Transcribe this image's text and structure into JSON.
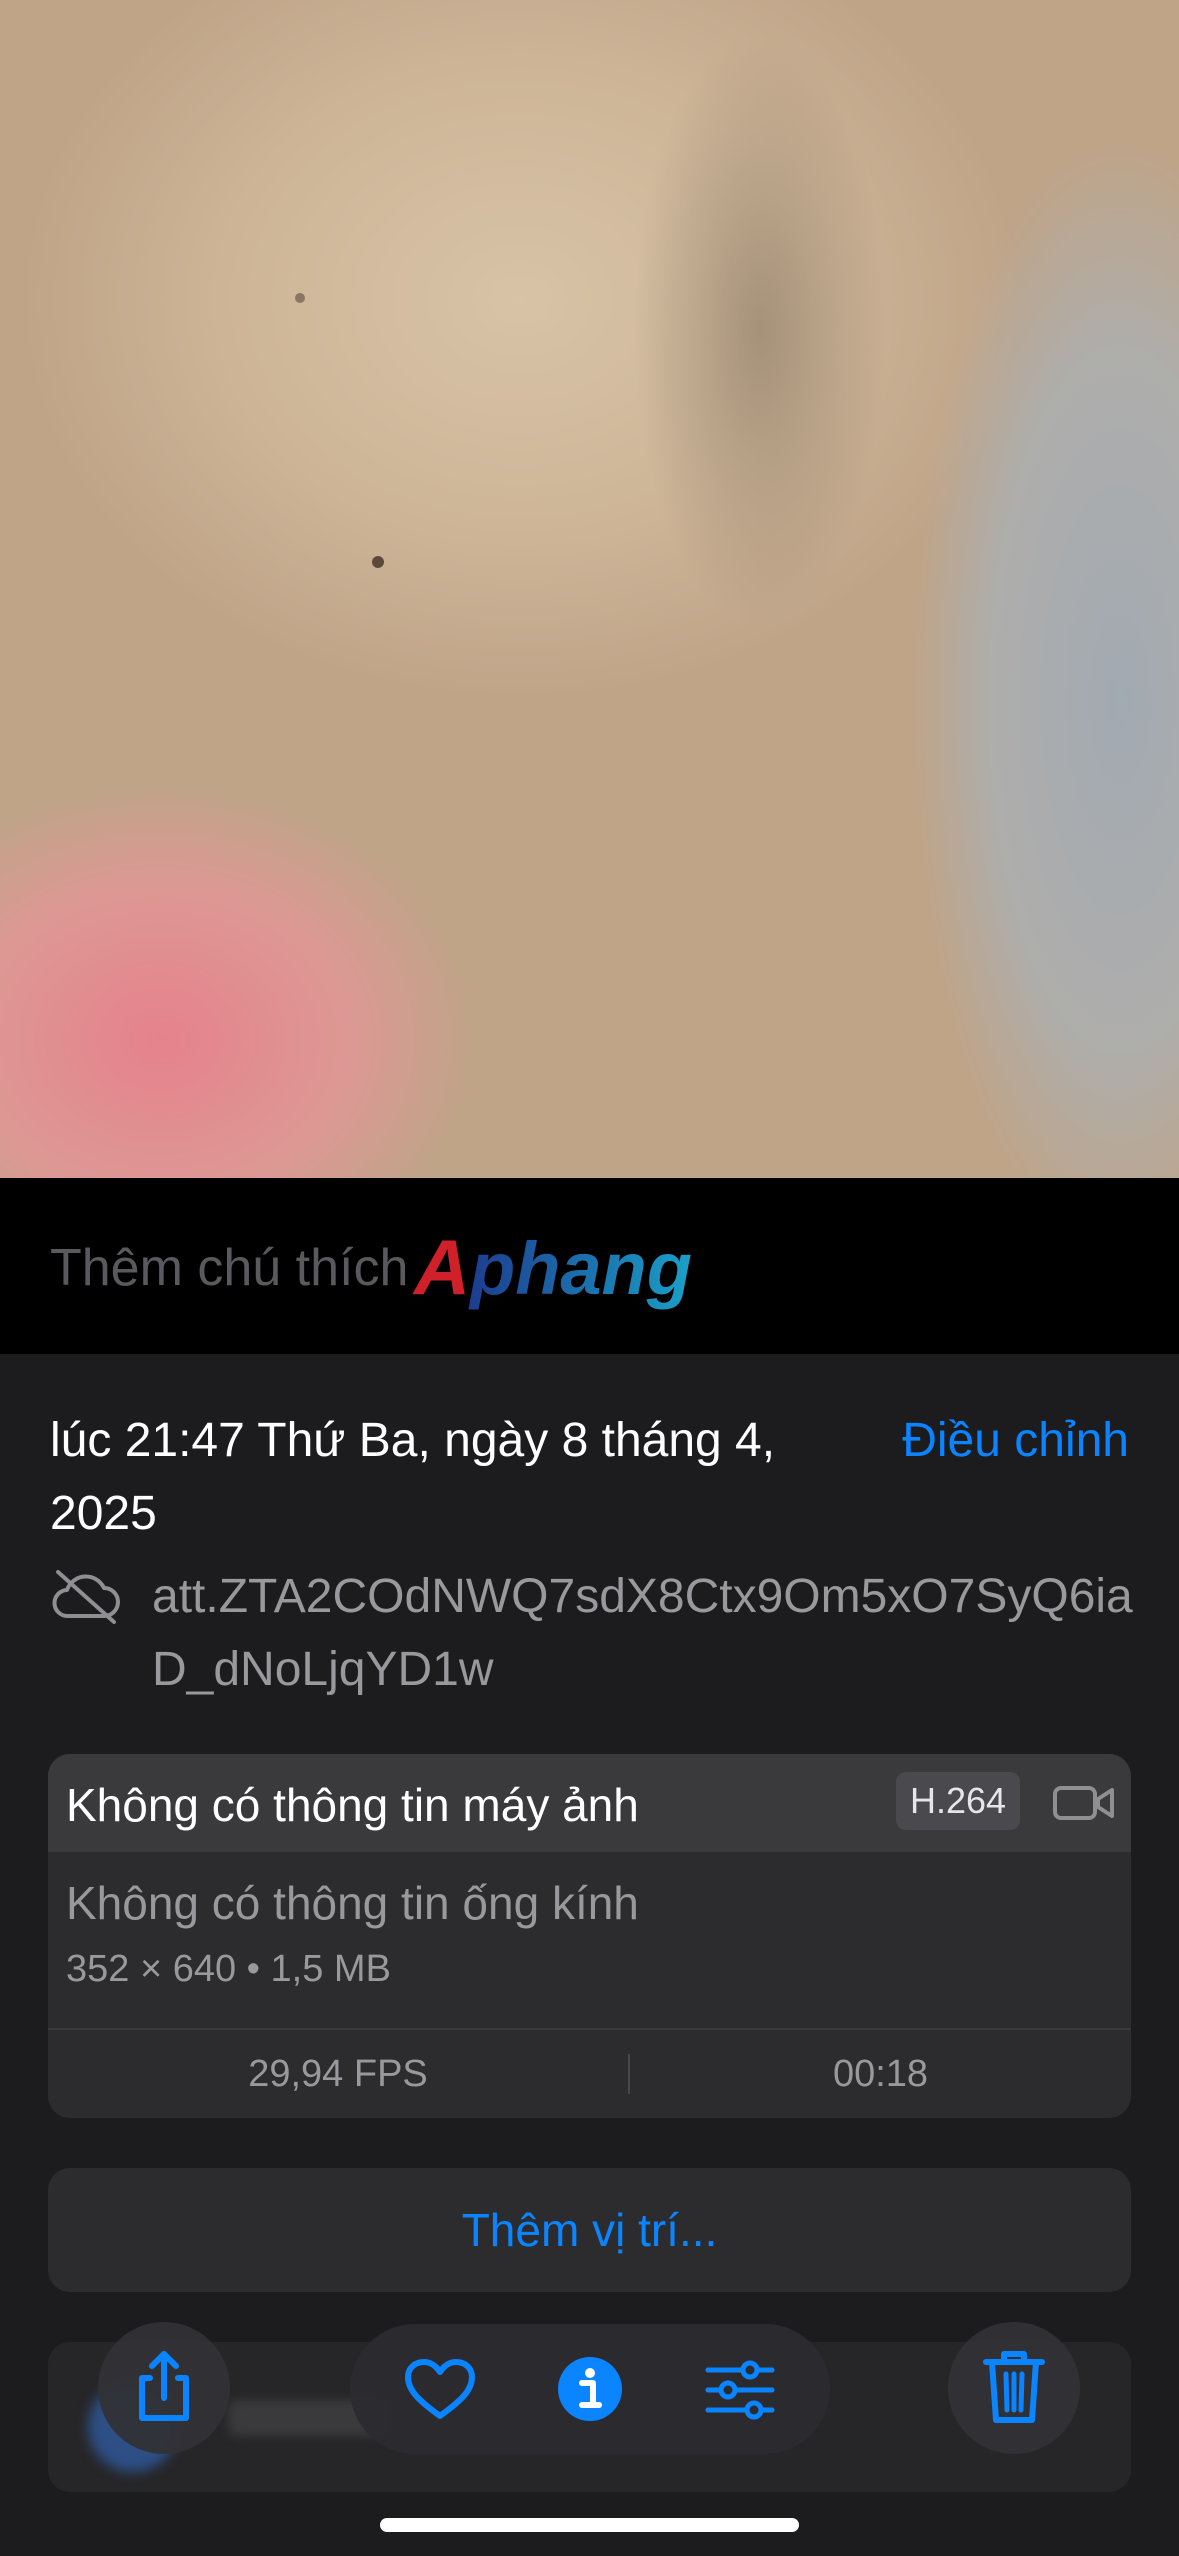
{
  "caption": {
    "placeholder": "Thêm chú thích",
    "watermark": "Aphang"
  },
  "info": {
    "date": "lúc 21:47 Thứ Ba, ngày 8 tháng 4, 2025",
    "adjust_label": "Điều chỉnh",
    "filename": "att.ZTA2COdNWQ7sdX8Ctx9Om5xO7SyQ6iaD_dNoLjqYD1w"
  },
  "card": {
    "title": "Không có thông tin máy ảnh",
    "codec": "H.264",
    "lens": "Không có thông tin ống kính",
    "resolution": "352 × 640 • 1,5 MB",
    "fps": "29,94 FPS",
    "duration": "00:18"
  },
  "location": {
    "add_label": "Thêm vị trí..."
  },
  "toolbar": {
    "icons": [
      "share-icon",
      "heart-icon",
      "info-icon",
      "adjust-sliders-icon",
      "trash-icon"
    ]
  },
  "colors": {
    "accent": "#0a84ff",
    "panel_background": "#1c1c1e",
    "card_background": "#2c2c2e"
  }
}
